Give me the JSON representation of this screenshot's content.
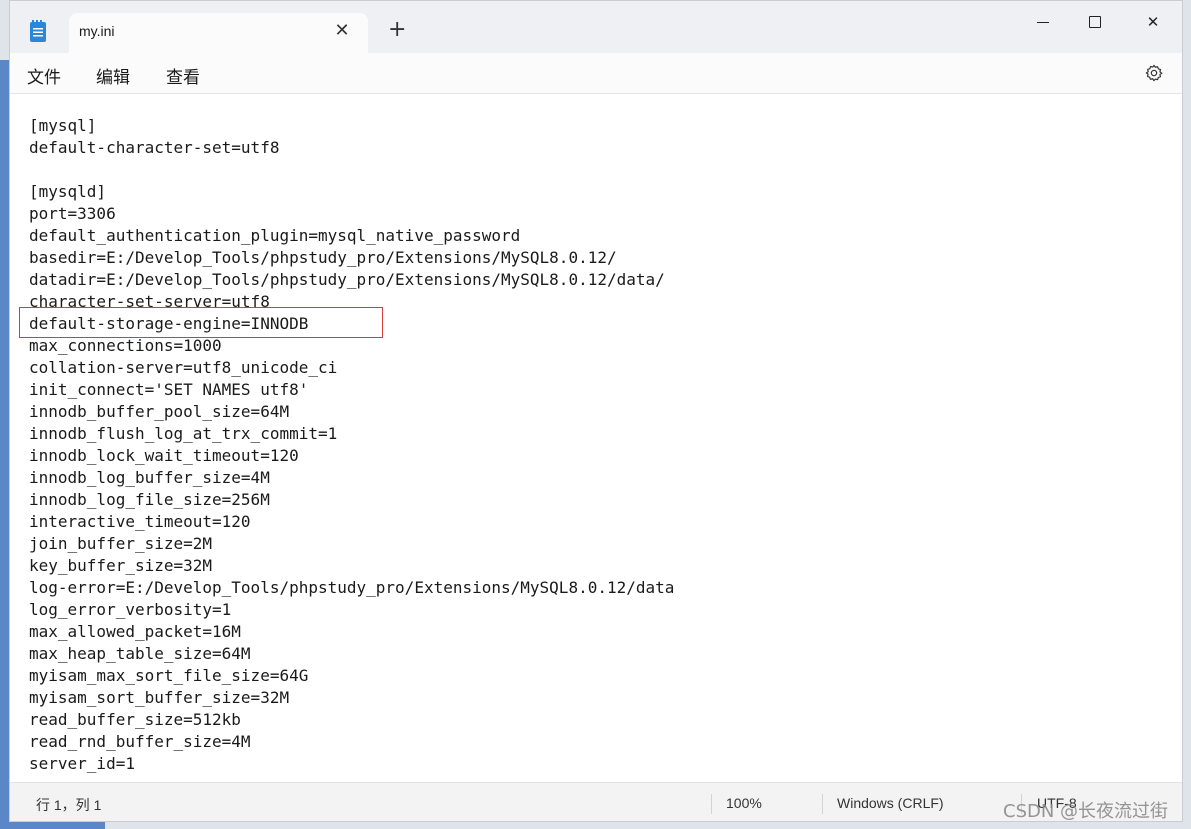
{
  "window": {
    "tab_title": "my.ini",
    "tab_close_glyph": "✕",
    "new_tab_glyph": "+",
    "close_glyph": "✕"
  },
  "menu": {
    "file": "文件",
    "edit": "编辑",
    "view": "查看"
  },
  "editor": {
    "lines": [
      "[mysql]",
      "default-character-set=utf8",
      "",
      "[mysqld]",
      "port=3306",
      "default_authentication_plugin=mysql_native_password",
      "basedir=E:/Develop_Tools/phpstudy_pro/Extensions/MySQL8.0.12/",
      "datadir=E:/Develop_Tools/phpstudy_pro/Extensions/MySQL8.0.12/data/",
      "character-set-server=utf8",
      "default-storage-engine=INNODB",
      "max_connections=1000",
      "collation-server=utf8_unicode_ci",
      "init_connect='SET NAMES utf8'",
      "innodb_buffer_pool_size=64M",
      "innodb_flush_log_at_trx_commit=1",
      "innodb_lock_wait_timeout=120",
      "innodb_log_buffer_size=4M",
      "innodb_log_file_size=256M",
      "interactive_timeout=120",
      "join_buffer_size=2M",
      "key_buffer_size=32M",
      "log-error=E:/Develop_Tools/phpstudy_pro/Extensions/MySQL8.0.12/data",
      "log_error_verbosity=1",
      "max_allowed_packet=16M",
      "max_heap_table_size=64M",
      "myisam_max_sort_file_size=64G",
      "myisam_sort_buffer_size=32M",
      "read_buffer_size=512kb",
      "read_rnd_buffer_size=4M",
      "server_id=1"
    ]
  },
  "status": {
    "position": "行 1，列 1",
    "zoom": "100%",
    "line_ending": "Windows (CRLF)",
    "encoding": "UTF-8"
  },
  "watermark": "CSDN @长夜流过街",
  "colors": {
    "highlight_border": "#d93b3b",
    "app_icon": "#2b88d8"
  }
}
